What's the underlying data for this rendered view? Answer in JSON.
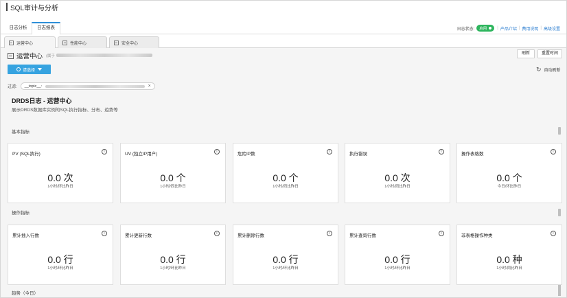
{
  "app": {
    "title": "SQL审计与分析"
  },
  "top_tabs": [
    {
      "label": "日志分析"
    },
    {
      "label": "日志报表"
    }
  ],
  "status": {
    "label": "日志状态:",
    "toggle": "启用",
    "links": [
      "产品介绍",
      "费用说明",
      "高级设置"
    ]
  },
  "sub_tabs": [
    {
      "label": "运营中心"
    },
    {
      "label": "性能中心"
    },
    {
      "label": "安全中心"
    }
  ],
  "page": {
    "title": "运营中心",
    "belongs_prefix": "(属于",
    "refresh_label": "刷新",
    "reset_label": "重置时间",
    "select_label": "请选择",
    "auto_refresh_label": "自动刷新",
    "filter_label": "过滤:",
    "filter_value": "__topic__:",
    "dash_title": "DRDS日志 - 运营中心",
    "dash_desc": "展示DRDS数据库实例的SQL执行指标、分布、趋势等"
  },
  "sections": {
    "basic": "基本指标",
    "ops": "操作指标",
    "trend": "趋势（今日）"
  },
  "basic_cards": [
    {
      "title": "PV (SQL执行)",
      "value": "0.0 次",
      "note": "1小时/环比昨日"
    },
    {
      "title": "UV (独立IP用户)",
      "value": "0.0 个",
      "note": "1小时/同比昨日"
    },
    {
      "title": "危险IP数",
      "value": "0.0 个",
      "note": "1小时/同比昨日"
    },
    {
      "title": "执行错误",
      "value": "0.0 次",
      "note": "1小时/同比昨日"
    },
    {
      "title": "操作表格数",
      "value": "0.0 个",
      "note": "今日/环比昨日"
    }
  ],
  "ops_cards": [
    {
      "title": "累计插入行数",
      "value": "0.0 行",
      "note": "1小时/环比昨日"
    },
    {
      "title": "累计更新行数",
      "value": "0.0 行",
      "note": "1小时/环比昨日"
    },
    {
      "title": "累计删除行数",
      "value": "0.0 行",
      "note": "1小时/环比昨日"
    },
    {
      "title": "累计查询行数",
      "value": "0.0 行",
      "note": "1小时/环比昨日"
    },
    {
      "title": "非表格操作种类",
      "value": "0.0 种",
      "note": "1小时/同比昨日"
    }
  ],
  "colors": {
    "accent": "#36a3e0",
    "toggle": "#2db55d",
    "link": "#2e7fd1"
  }
}
